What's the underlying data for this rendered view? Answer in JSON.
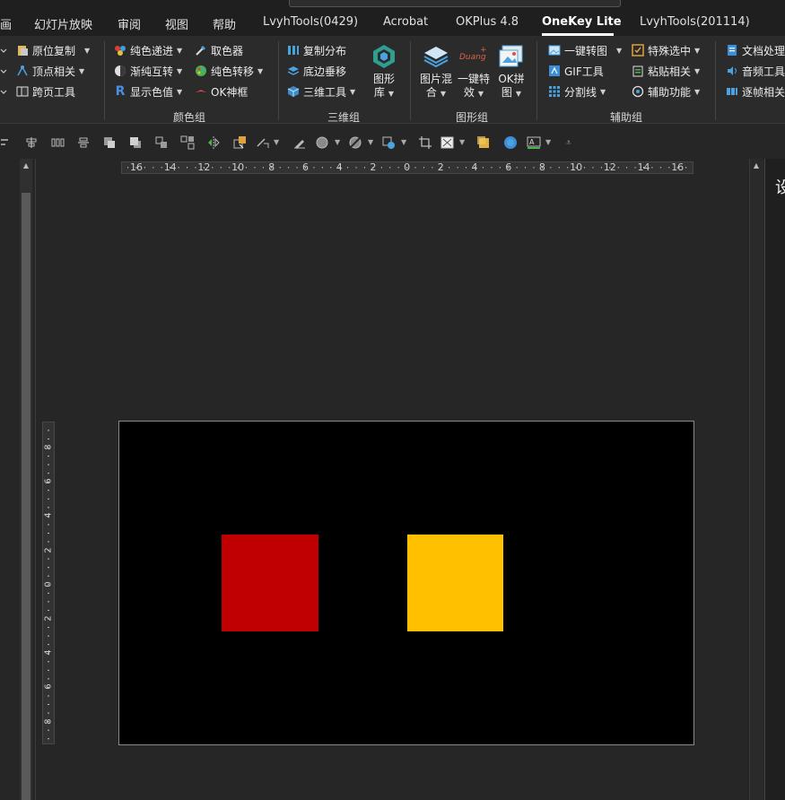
{
  "tabs": [
    {
      "label": "画"
    },
    {
      "label": "幻灯片放映"
    },
    {
      "label": "审阅"
    },
    {
      "label": "视图"
    },
    {
      "label": "帮助"
    },
    {
      "label": "LvyhTools(0429)"
    },
    {
      "label": "Acrobat"
    },
    {
      "label": "OKPlus 4.8"
    },
    {
      "label": "OneKey Lite",
      "active": true
    },
    {
      "label": "LvyhTools(201114)"
    }
  ],
  "ribbon": {
    "group0": {
      "items": [
        "原位复制",
        "顶点相关",
        "跨页工具"
      ]
    },
    "color_group": {
      "label": "颜色组",
      "col1": [
        "纯色递进",
        "渐纯互转",
        "显示色值"
      ],
      "col2": [
        "取色器",
        "纯色转移",
        "OK神框"
      ]
    },
    "3d_group": {
      "label": "三维组",
      "items": [
        "复制分布",
        "底边垂移",
        "三维工具"
      ],
      "big": {
        "line1": "图形",
        "line2": "库"
      }
    },
    "shape_group": {
      "label": "图形组",
      "big1": {
        "line1": "图片混",
        "line2": "合"
      },
      "big2": {
        "line1": "一键特",
        "line2": "效",
        "overlay": "Duang"
      },
      "big3": {
        "line1": "OK拼",
        "line2": "图"
      }
    },
    "assist_group": {
      "label": "辅助组",
      "col1": [
        "一键转图",
        "GIF工具",
        "分割线"
      ],
      "col2": [
        "特殊选中",
        "粘贴相关",
        "辅助功能"
      ],
      "col3": [
        "文档处理",
        "音频工具",
        "逐帧相关"
      ]
    }
  },
  "ruler_h": [
    "16",
    "14",
    "12",
    "10",
    "8",
    "6",
    "4",
    "2",
    "0",
    "2",
    "4",
    "6",
    "8",
    "10",
    "12",
    "14",
    "16"
  ],
  "ruler_v": [
    "8",
    "6",
    "4",
    "2",
    "0",
    "2",
    "4",
    "6",
    "8"
  ],
  "slide": {
    "background": "#000000",
    "shapes": [
      {
        "name": "red-square",
        "color": "#C00000"
      },
      {
        "name": "yellow-square",
        "color": "#FFC000"
      }
    ]
  },
  "right_pane": {
    "text": "设"
  },
  "colors": {
    "accent": "#ffffff",
    "ribbon_bg": "#2b2b2b",
    "tab_bg": "#1f1f1f"
  }
}
